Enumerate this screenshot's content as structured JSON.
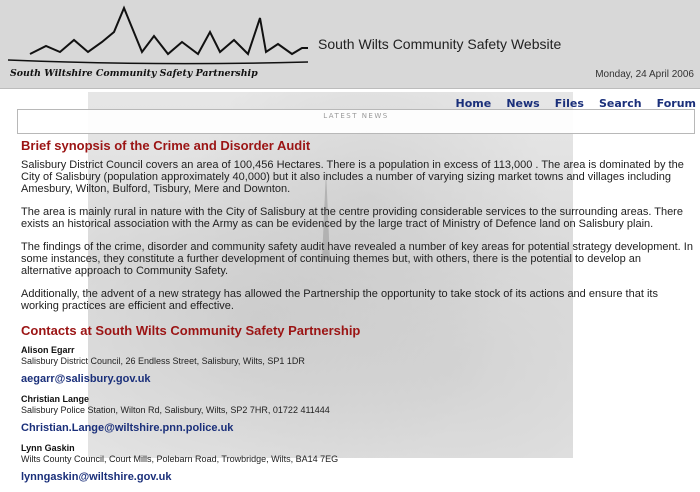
{
  "header": {
    "logo_text": "South Wiltshire Community Safety Partnership",
    "site_title": "South Wilts Community Safety Website",
    "date": "Monday, 24 April 2006"
  },
  "nav": {
    "items": [
      {
        "label": "Home"
      },
      {
        "label": "News"
      },
      {
        "label": "Files"
      },
      {
        "label": "Search"
      },
      {
        "label": "Forum"
      }
    ]
  },
  "news_bar": {
    "label": "LATEST NEWS"
  },
  "main": {
    "heading": "Brief synopsis of the Crime and Disorder Audit",
    "paragraphs": [
      "Salisbury District Council covers an area of 100,456 Hectares. There is a population in excess of 113,000 . The area is dominated by the City of Salisbury (population approximately 40,000) but it also includes a number of varying sizing market towns and villages including Amesbury, Wilton, Bulford, Tisbury, Mere and Downton.",
      "The area is mainly rural in nature with the City of Salisbury at the centre providing considerable services to the surrounding areas. There exists an historical association with the Army as can be evidenced by the large tract of Ministry of Defence land on Salisbury plain.",
      "The findings of the crime, disorder and community safety audit have revealed a number of key areas for potential strategy development. In some instances, they constitute a further development of continuing themes but, with others, there is the potential to develop an alternative approach to Community Safety.",
      "Additionally, the advent of a new strategy has allowed the Partnership the opportunity to take stock of its actions and ensure that its working practices are efficient and effective."
    ],
    "contacts_heading": "Contacts at South Wilts Community Safety Partnership",
    "contacts": [
      {
        "name": "Alison Egarr",
        "address": "Salisbury District Council, 26 Endless Street, Salisbury, Wilts, SP1 1DR",
        "email": "aegarr@salisbury.gov.uk"
      },
      {
        "name": "Christian Lange",
        "address": "Salisbury Police Station, Wilton Rd, Salisbury, Wilts, SP2 7HR, 01722 411444",
        "email": "Christian.Lange@wiltshire.pnn.police.uk"
      },
      {
        "name": "Lynn Gaskin",
        "address": "Wilts County Council, Court Mills, Polebarn Road, Trowbridge, Wilts, BA14 7EG",
        "email": "lynngaskin@wiltshire.gov.uk"
      }
    ]
  }
}
